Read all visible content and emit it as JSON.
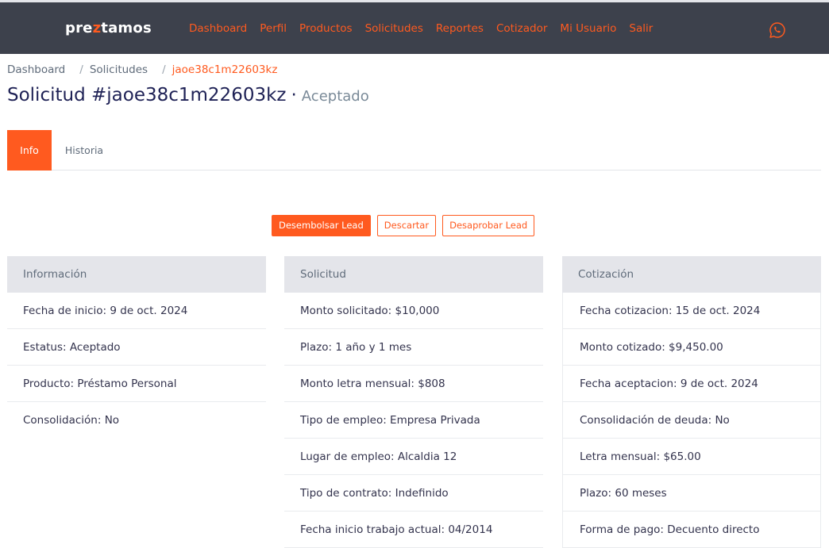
{
  "brand": {
    "logo_a": "pre",
    "logo_z": "z",
    "logo_b": "tamos",
    "accent_color": "#ff5a1f",
    "navbar_color": "#3d414c"
  },
  "nav": {
    "items": [
      {
        "label": "Dashboard"
      },
      {
        "label": "Perfil"
      },
      {
        "label": "Productos"
      },
      {
        "label": "Solicitudes"
      },
      {
        "label": "Reportes"
      },
      {
        "label": "Cotizador"
      },
      {
        "label": "Mi Usuario"
      },
      {
        "label": "Salir"
      }
    ],
    "whatsapp_icon": "whatsapp-icon"
  },
  "breadcrumb": {
    "items": [
      "Dashboard",
      "Solicitudes"
    ],
    "separator": "/",
    "active": "jaoe38c1m22603kz"
  },
  "page": {
    "title": "Solicitud #jaoe38c1m22603kz",
    "dot": "·",
    "status": "Aceptado"
  },
  "tabs": {
    "info": "Info",
    "history": "Historia"
  },
  "actions": {
    "disburse": "Desembolsar Lead",
    "discard": "Descartar",
    "disapprove": "Desaprobar Lead"
  },
  "cards": {
    "info": {
      "title": "Información",
      "rows": [
        "Fecha de inicio: 9 de oct. 2024",
        "Estatus: Aceptado",
        "Producto: Préstamo Personal",
        "Consolidación: No"
      ]
    },
    "request": {
      "title": "Solicitud",
      "rows": [
        "Monto solicitado: $10,000",
        "Plazo: 1 año y 1 mes",
        "Monto letra mensual: $808",
        "Tipo de empleo: Empresa Privada",
        "Lugar de empleo: Alcaldia 12",
        "Tipo de contrato: Indefinido",
        "Fecha inicio trabajo actual: 04/2014"
      ]
    },
    "quote": {
      "title": "Cotización",
      "rows": [
        "Fecha cotizacion: 15 de oct. 2024",
        "Monto cotizado: $9,450.00",
        "Fecha aceptacion: 9 de oct. 2024",
        "Consolidación de deuda: No",
        "Letra mensual: $65.00",
        "Plazo: 60 meses",
        "Forma de pago: Decuento directo"
      ]
    }
  }
}
